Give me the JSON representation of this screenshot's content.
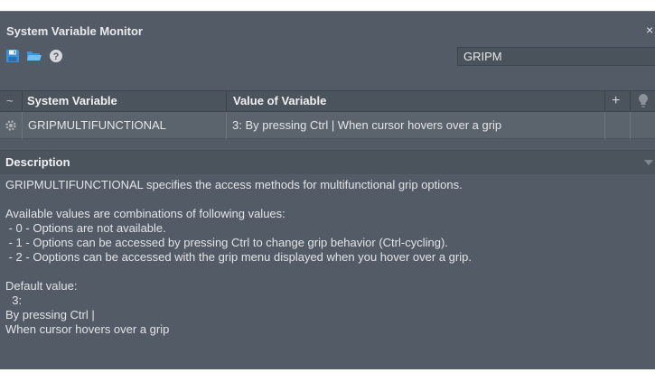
{
  "window": {
    "title": "System Variable Monitor",
    "close_glyph": "×"
  },
  "toolbar": {
    "icons": [
      "save-icon",
      "open-folder-icon",
      "help-icon"
    ],
    "search_value": "GRIPM"
  },
  "grid": {
    "headers": {
      "toggle": "~",
      "system_variable": "System Variable",
      "value_of_variable": "Value of Variable",
      "add_glyph": "+"
    },
    "rows": [
      {
        "icon": "gear-icon",
        "name": "GRIPMULTIFUNCTIONAL",
        "value": "3: By pressing Ctrl | When cursor hovers over a grip"
      }
    ]
  },
  "description": {
    "title": "Description",
    "lines": [
      "GRIPMULTIFUNCTIONAL specifies the access methods for multifunctional grip options.",
      "",
      "Available values are combinations of following values:",
      " - 0 - Options are not available.",
      " - 1 - Options can be accessed by pressing Ctrl to change grip behavior (Ctrl-cycling).",
      " - 2 - Ooptions can be accessed with the grip menu displayed when you hover over a grip.",
      "",
      "Default value:",
      "  3:",
      "By pressing Ctrl |",
      "When cursor hovers over a grip"
    ]
  },
  "colors": {
    "panel_bg": "#535b66",
    "header_bg": "#4b535d",
    "save_icon": "#4aa3e8",
    "folder_icon": "#59b3f0"
  }
}
